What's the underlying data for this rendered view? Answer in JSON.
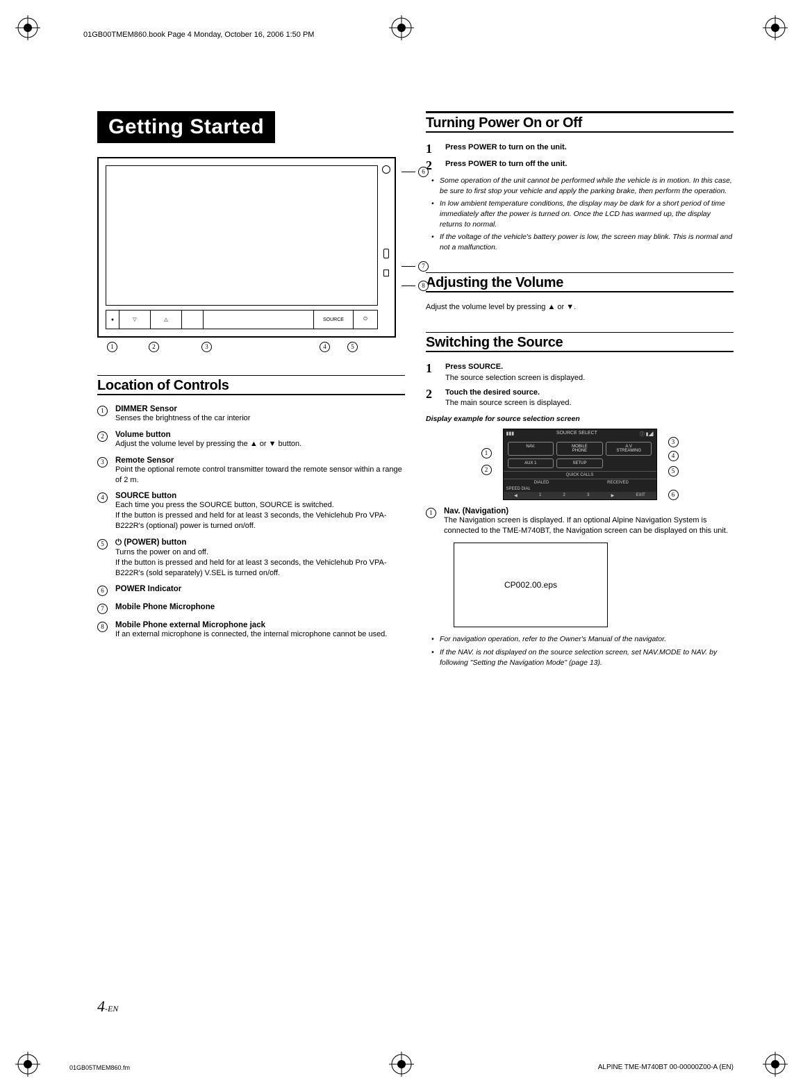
{
  "header_text": "01GB00TMEM860.book  Page 4  Monday, October 16, 2006  1:50 PM",
  "banner_title": "Getting Started",
  "sections": {
    "location_title": "Location of Controls",
    "power_title": "Turning Power On or Off",
    "volume_title": "Adjusting the Volume",
    "source_title": "Switching the Source"
  },
  "controls": [
    {
      "title": "DIMMER Sensor",
      "desc": "Senses the brightness of the car interior"
    },
    {
      "title": "Volume button",
      "desc": "Adjust the volume level by pressing the ▲ or ▼ button."
    },
    {
      "title": "Remote Sensor",
      "desc": "Point the optional remote control transmitter toward the remote sensor within a range of 2 m."
    },
    {
      "title": "SOURCE button",
      "desc": "Each time you press the SOURCE button, SOURCE is switched.\nIf the button is pressed and held for at least 3 seconds, the Vehiclehub Pro VPA-B222R's (optional) power is turned on/off."
    },
    {
      "title": "⏻ (POWER) button",
      "desc": "Turns the power on and off.\nIf the button is pressed and held for at least 3 seconds, the Vehiclehub Pro VPA-B222R's (sold separately) V.SEL is turned on/off."
    },
    {
      "title": "POWER Indicator",
      "desc": ""
    },
    {
      "title": "Mobile Phone Microphone",
      "desc": ""
    },
    {
      "title": "Mobile Phone external Microphone jack",
      "desc": "If an external microphone is connected, the internal microphone cannot be used."
    }
  ],
  "power_steps": {
    "s1": "Press POWER to turn on the unit.",
    "s2": "Press POWER to turn off the unit."
  },
  "power_notes": [
    "Some operation of the unit cannot be performed while the vehicle is in motion. In this case, be sure to first stop your vehicle and apply the parking brake, then perform the operation.",
    "In low ambient temperature conditions, the display may be dark for a short period of time immediately after the power is turned on. Once the LCD has warmed up, the display returns to normal.",
    "If the voltage of the vehicle's battery power is low, the screen may blink. This is normal and not a malfunction."
  ],
  "volume_line": "Adjust the volume level by pressing ▲ or ▼.",
  "source_steps": {
    "s1_title": "Press SOURCE.",
    "s1_desc": "The source selection screen is displayed.",
    "s2_title": "Touch the desired source.",
    "s2_desc": "The main source screen is displayed."
  },
  "example_caption": "Display example for source selection screen",
  "src_screen": {
    "title": "SOURCE  SELECT",
    "buttons": [
      "NAV.",
      "MOBILE\nPHONE",
      "A.V\nSTREAMING",
      "AUX 1",
      "SETUP",
      ""
    ],
    "tabs_label": "QUICK CALLS",
    "tabs": [
      "DIALED",
      "RECEIVED"
    ],
    "speed": "SPEED DIAL",
    "footer": [
      "◀",
      "1",
      "2",
      "3",
      "▶",
      "EXIT"
    ]
  },
  "nav_item": {
    "title": "Nav. (Navigation)",
    "desc": "The Navigation screen is displayed. If an optional Alpine Navigation System is connected to the TME-M740BT, the Navigation screen can be displayed on this unit."
  },
  "eps_label": "CP002.00.eps",
  "nav_notes": [
    "For navigation operation, refer to the Owner's Manual of the navigator.",
    "If the NAV. is not displayed on the source selection screen, set NAV.MODE to NAV. by following \"Setting the Navigation Mode\" (page 13)."
  ],
  "page_number_main": "4",
  "page_number_suffix": "-EN",
  "footer_left": "01GB05TMEM860.fm",
  "footer_right": "ALPINE TME-M740BT 00-00000Z00-A (EN)"
}
